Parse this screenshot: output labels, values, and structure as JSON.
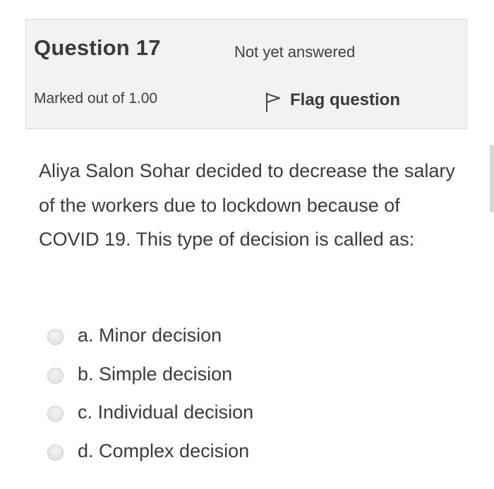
{
  "question_info": {
    "title": "Question 17",
    "state": "Not yet answered",
    "grade": "Marked out of 1.00",
    "flag_label": "Flag question"
  },
  "question": {
    "text": "Aliya Salon Sohar decided to decrease the salary of the workers due to lockdown because of COVID 19. This type of decision is called as:",
    "answers": [
      {
        "label": "a. Minor decision",
        "selected": false
      },
      {
        "label": "b. Simple decision",
        "selected": false
      },
      {
        "label": "c. Individual decision",
        "selected": false
      },
      {
        "label": "d. Complex decision",
        "selected": false
      }
    ]
  },
  "icons": {
    "flag": "flag-icon"
  }
}
